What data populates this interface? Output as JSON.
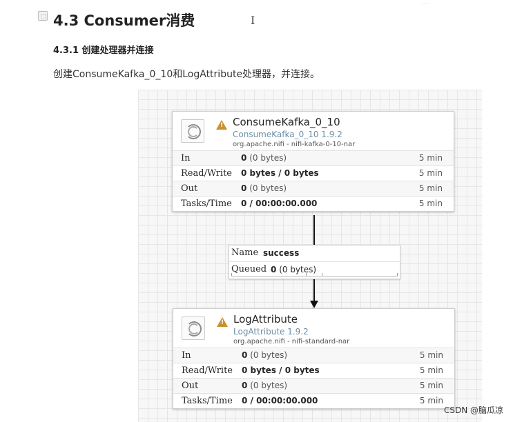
{
  "document": {
    "heading": "4.3 Consumer消费",
    "cursor_glyph": "I",
    "faded_corner_text": "…",
    "subheading": "4.3.1 创建处理器并连接",
    "paragraph": "创建ConsumeKafka_0_10和LogAttribute处理器，并连接。"
  },
  "flow": {
    "processors": [
      {
        "name": "ConsumeKafka_0_10",
        "type": "ConsumeKafka_0_10 1.9.2",
        "bundle": "org.apache.nifi - nifi-kafka-0-10-nar",
        "warning_icon": "warning-triangle-icon",
        "stats": [
          {
            "label": "In",
            "value": "0",
            "detail": "(0 bytes)",
            "window": "5 min"
          },
          {
            "label": "Read/Write",
            "value": "0 bytes / 0 bytes",
            "detail": "",
            "window": "5 min"
          },
          {
            "label": "Out",
            "value": "0",
            "detail": "(0 bytes)",
            "window": "5 min"
          },
          {
            "label": "Tasks/Time",
            "value": "0 / 00:00:00.000",
            "detail": "",
            "window": "5 min"
          }
        ]
      },
      {
        "name": "LogAttribute",
        "type": "LogAttribute 1.9.2",
        "bundle": "org.apache.nifi - nifi-standard-nar",
        "warning_icon": "warning-triangle-icon",
        "stats": [
          {
            "label": "In",
            "value": "0",
            "detail": "(0 bytes)",
            "window": "5 min"
          },
          {
            "label": "Read/Write",
            "value": "0 bytes / 0 bytes",
            "detail": "",
            "window": "5 min"
          },
          {
            "label": "Out",
            "value": "0",
            "detail": "(0 bytes)",
            "window": "5 min"
          },
          {
            "label": "Tasks/Time",
            "value": "0 / 00:00:00.000",
            "detail": "",
            "window": "5 min"
          }
        ]
      }
    ],
    "connection": {
      "name_label": "Name",
      "name_value": "success",
      "queued_label": "Queued",
      "queued_value": "0",
      "queued_detail": "(0 bytes)"
    }
  },
  "watermark": "CSDN @脑瓜凉"
}
